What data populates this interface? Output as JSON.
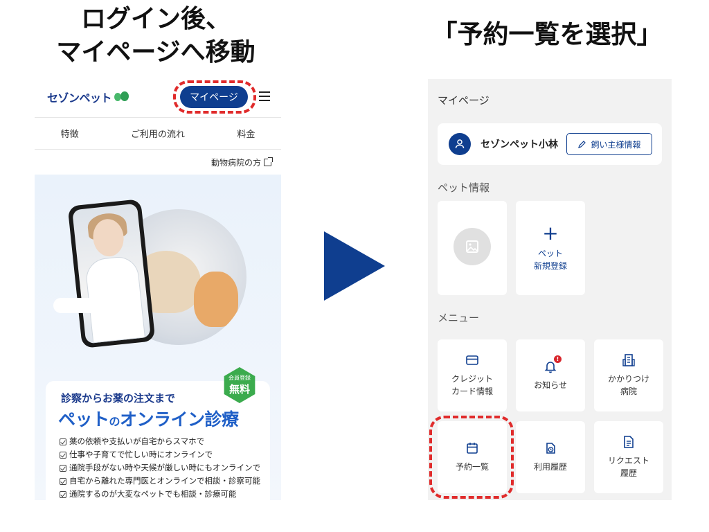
{
  "captions": {
    "left_line1": "ログイン後、",
    "left_line2": "マイページへ移動",
    "right": "「予約一覧を選択」"
  },
  "left_screen": {
    "logo": "セゾンペット",
    "mypage_button": "マイページ",
    "nav": [
      "特徴",
      "ご利用の流れ",
      "料金"
    ],
    "hospital_link": "動物病院の方",
    "badge_small": "会員登録",
    "badge_big": "無料",
    "promo_subtitle": "診察からお薬の注文まで",
    "promo_title_a": "ペット",
    "promo_title_no": "の",
    "promo_title_b": "オンライン診療",
    "features": [
      "薬の依頼や支払いが自宅からスマホで",
      "仕事や子育てで忙しい時にオンラインで",
      "通院手段がない時や天候が厳しい時にもオンラインで",
      "自宅から離れた専門医とオンラインで相談・診察可能",
      "通院するのが大変なペットでも相談・診療可能"
    ]
  },
  "right_screen": {
    "title": "マイページ",
    "user_name": "セゾンペット小林",
    "owner_button": "飼い主様情報",
    "pet_section": "ペット情報",
    "pet_add_line1": "ペット",
    "pet_add_line2": "新規登録",
    "menu_section": "メニュー",
    "menu": {
      "credit_line1": "クレジット",
      "credit_line2": "カード情報",
      "notice": "お知らせ",
      "notice_badge": "!",
      "clinic_line1": "かかりつけ",
      "clinic_line2": "病院",
      "reservations": "予約一覧",
      "history": "利用履歴",
      "request_line1": "リクエスト",
      "request_line2": "履歴"
    }
  },
  "colors": {
    "brand_navy": "#0f3e8f",
    "highlight_red": "#e02b2b",
    "badge_green": "#3bab4d"
  }
}
